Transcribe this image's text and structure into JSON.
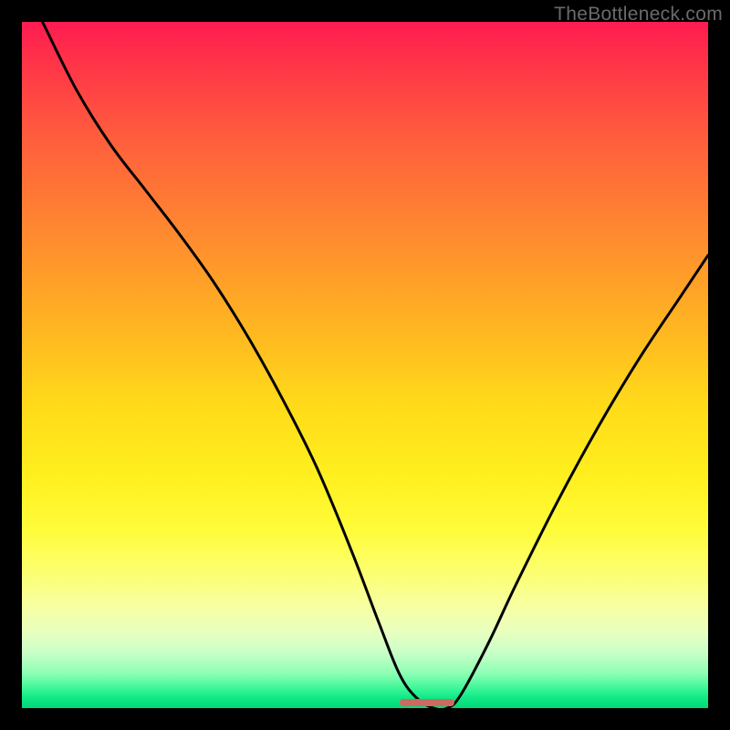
{
  "watermark": "TheBottleneck.com",
  "chart_data": {
    "type": "line",
    "title": "",
    "xlabel": "",
    "ylabel": "",
    "xlim": [
      0,
      100
    ],
    "ylim": [
      0,
      100
    ],
    "grid": false,
    "legend": false,
    "background": {
      "type": "vertical-gradient",
      "stops": [
        {
          "pos": 0,
          "color": "#ff1b52"
        },
        {
          "pos": 6,
          "color": "#ff3448"
        },
        {
          "pos": 16,
          "color": "#ff5a3e"
        },
        {
          "pos": 26,
          "color": "#ff7a34"
        },
        {
          "pos": 36,
          "color": "#ff9a2a"
        },
        {
          "pos": 46,
          "color": "#ffba20"
        },
        {
          "pos": 56,
          "color": "#ffdb1a"
        },
        {
          "pos": 66,
          "color": "#ffef1e"
        },
        {
          "pos": 74,
          "color": "#fffc3a"
        },
        {
          "pos": 80,
          "color": "#fcff6e"
        },
        {
          "pos": 85,
          "color": "#f7ffa0"
        },
        {
          "pos": 89,
          "color": "#e8ffc0"
        },
        {
          "pos": 92,
          "color": "#c8ffc8"
        },
        {
          "pos": 95,
          "color": "#8cffb4"
        },
        {
          "pos": 97,
          "color": "#40f79a"
        },
        {
          "pos": 98.5,
          "color": "#11e886"
        },
        {
          "pos": 100,
          "color": "#00d876"
        }
      ]
    },
    "series": [
      {
        "name": "bottleneck-curve",
        "color": "#000000",
        "stroke_width": 3,
        "x": [
          0,
          3,
          8,
          13,
          18,
          23,
          28,
          33,
          38,
          43,
          48,
          52,
          55,
          57.5,
          60,
          62,
          64,
          68,
          72,
          78,
          84,
          90,
          96,
          100
        ],
        "y": [
          106,
          100,
          90,
          82,
          75.5,
          69,
          62,
          54,
          45,
          35,
          23,
          12.5,
          5,
          1.5,
          0,
          0,
          2,
          9.5,
          18,
          30,
          41,
          51,
          60,
          66
        ]
      }
    ],
    "marker": {
      "name": "optimal-range",
      "color": "#cc6a62",
      "x_start": 55,
      "x_end": 63,
      "y": 0
    }
  }
}
